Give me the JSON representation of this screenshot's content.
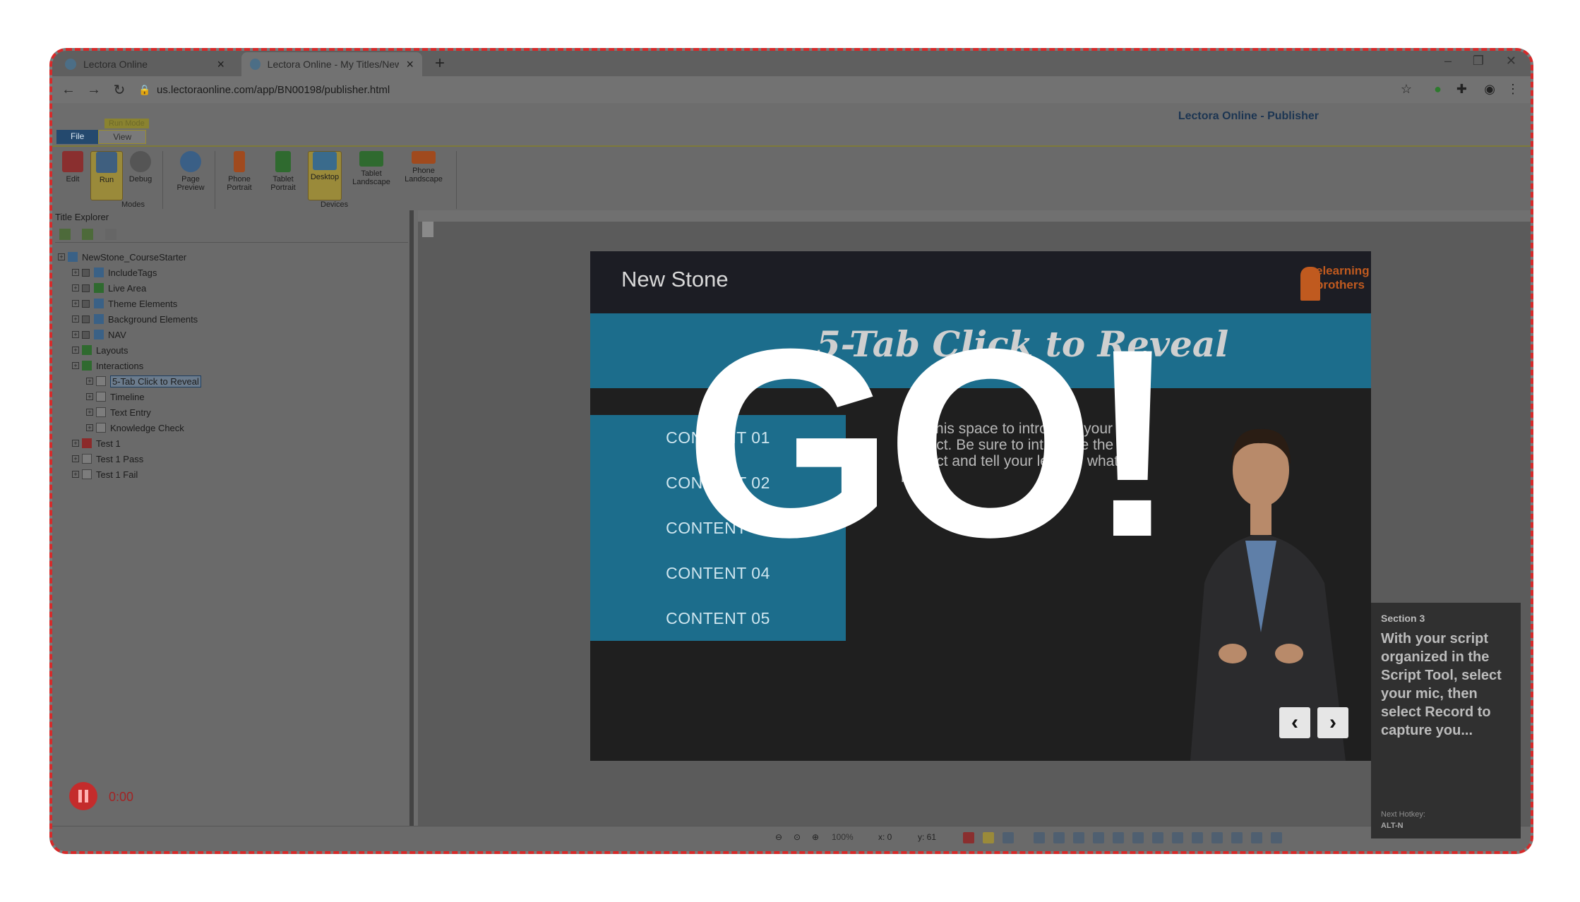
{
  "browser": {
    "tabs": [
      {
        "title": "Lectora Online",
        "active": false
      },
      {
        "title": "Lectora Online - My Titles/New S",
        "active": true
      }
    ],
    "url": "us.lectoraonline.com/app/BN00198/publisher.html"
  },
  "app": {
    "title": "Lectora Online - Publisher",
    "ribbon_tabs": [
      "File",
      "View"
    ],
    "run_mode_label": "Run Mode",
    "modes": [
      "Edit",
      "Run",
      "Debug"
    ],
    "modes_group": "Modes",
    "page_preview": "Page Preview",
    "devices": [
      "Phone Portrait",
      "Tablet Portrait",
      "Desktop",
      "Tablet Landscape",
      "Phone Landscape"
    ],
    "devices_group": "Devices"
  },
  "explorer": {
    "title": "Title Explorer",
    "tree": [
      {
        "label": "NewStone_CourseStarter",
        "depth": 0
      },
      {
        "label": "IncludeTags",
        "depth": 1
      },
      {
        "label": "Live Area",
        "depth": 1
      },
      {
        "label": "Theme Elements",
        "depth": 1
      },
      {
        "label": "Background Elements",
        "depth": 1
      },
      {
        "label": "NAV",
        "depth": 1
      },
      {
        "label": "Layouts",
        "depth": 1
      },
      {
        "label": "Interactions",
        "depth": 1
      },
      {
        "label": "5-Tab Click to Reveal",
        "depth": 2,
        "selected": true
      },
      {
        "label": "Timeline",
        "depth": 2
      },
      {
        "label": "Text Entry",
        "depth": 2
      },
      {
        "label": "Knowledge Check",
        "depth": 2
      },
      {
        "label": "Test 1",
        "depth": 1
      },
      {
        "label": "Test 1 Pass",
        "depth": 1
      },
      {
        "label": "Test 1 Fail",
        "depth": 1
      }
    ]
  },
  "recorder": {
    "time": "0:00"
  },
  "slide": {
    "title": "New Stone",
    "logo": "elearning brothers",
    "banner": "5-Tab Click to Reveal",
    "buttons": [
      "CONTENT 01",
      "CONTENT 02",
      "CONTENT 03",
      "CONTENT 04",
      "CONTENT 05"
    ],
    "body": "Use this space to introduce your subject. Be sure to introduce the subject and tell your learner what is next.",
    "overlay": "GO!"
  },
  "script_panel": {
    "section": "Section 3",
    "text": "With your script organized in the Script Tool, select your mic, then select Record to capture you...",
    "hotkey_label": "Next Hotkey:",
    "hotkey": "ALT-N"
  },
  "statusbar": {
    "zoom": "100%",
    "x": "x: 0",
    "y": "y: 61"
  },
  "colors": {
    "accent": "#1c6d8c",
    "frame_border": "#d62a2a",
    "record": "#c42c2c"
  }
}
